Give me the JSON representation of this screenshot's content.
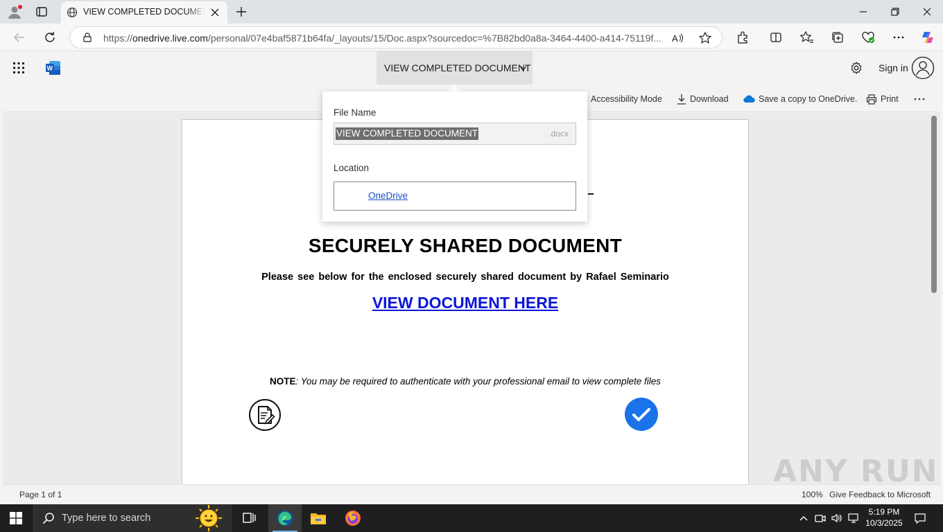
{
  "browser": {
    "tab_title": "VIEW COMPLETED DOCUMENT.docx",
    "url_prefix": "https://",
    "url_host": "onedrive.live.com",
    "url_path": "/personal/07e4baf5871b64fa/_layouts/15/Doc.aspx?sourcedoc=%7B82bd0a8a-3464-4400-a414-75119f..."
  },
  "word": {
    "doc_title": "VIEW COMPLETED DOCUMENT",
    "sign_in": "Sign in",
    "toolbar": {
      "accessibility": "Accessibility Mode",
      "download": "Download",
      "save_copy": "Save a copy to OneDrive.",
      "print": "Print"
    }
  },
  "popup": {
    "file_name_label": "File Name",
    "file_name_value": "VIEW COMPLETED DOCUMENT",
    "file_ext": ".docx",
    "location_label": "Location",
    "location_link": "OneDrive"
  },
  "document": {
    "heading": "SECURELY SHARED DOCUMENT",
    "subline": "Please see below for the enclosed securely shared document by Rafael Seminario",
    "link_text": "VIEW DOCUMENT HERE",
    "note_label": "NOTE",
    "note_text": ": You may be required to authenticate with your professional email to view complete files"
  },
  "status": {
    "page": "Page 1 of 1",
    "zoom": "100%",
    "feedback": "Give Feedback to Microsoft"
  },
  "watermark": "ANY RUN",
  "taskbar": {
    "search_placeholder": "Type here to search",
    "time": "5:19 PM",
    "date": "10/3/2025"
  },
  "colors": {
    "link_blue": "#0b16d6",
    "check_blue": "#1a73e8",
    "word_blue": "#185abd"
  }
}
